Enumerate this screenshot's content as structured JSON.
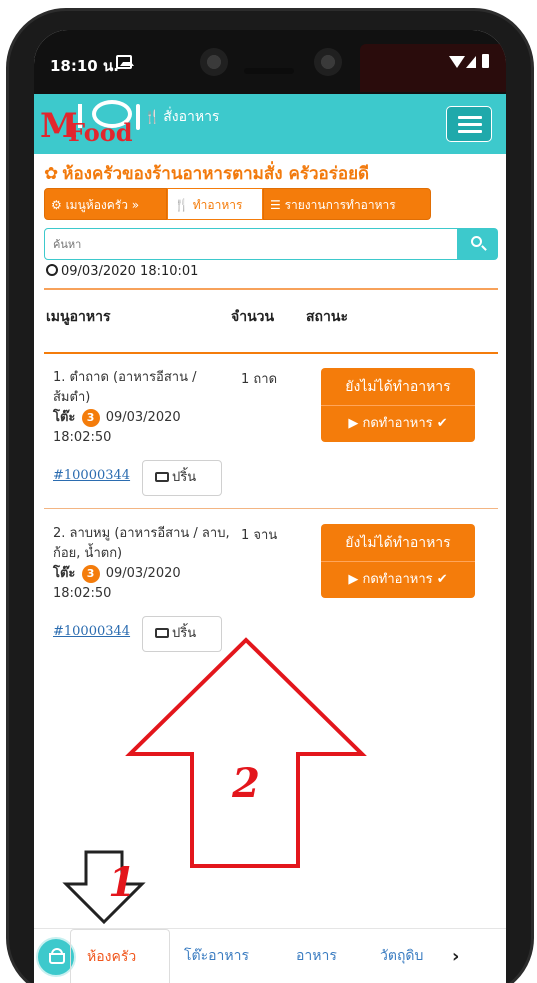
{
  "status_bar": {
    "time": "18:10 น."
  },
  "navbar": {
    "logo_m": "M",
    "logo_food": "Food",
    "order_icon": "🍴",
    "order_label": "สั่งอาหาร"
  },
  "page": {
    "title": "ห้องครัวของร้านอาหารตามสั่ง ครัวอร่อยดี",
    "buttons": {
      "kitchen_menu": "⚙ เมนูห้องครัว »",
      "cook": "🍴 ทำอาหาร",
      "report": "☰ รายงานการทำอาหาร"
    },
    "search_placeholder": "ค้นหา",
    "timestamp": "09/03/2020 18:10:01"
  },
  "table": {
    "headers": {
      "menu": "เมนูอาหาร",
      "qty": "จำนวน",
      "status": "สถานะ"
    },
    "rows": [
      {
        "name": "1. ตำถาด (อาหารอีสาน / ส้มตำ)",
        "table_label": "โต๊ะ",
        "table_no": "3",
        "ordered_at": "09/03/2020 18:02:50",
        "order_no": "#10000344",
        "print_label": "ปริ้น",
        "qty": "1 ถาด",
        "status": "ยังไม่ได้ทำอาหาร",
        "action": "▶ กดทำอาหาร ✔"
      },
      {
        "name": "2. ลาบหมู (อาหารอีสาน / ลาบ, ก้อย, น้ำตก)",
        "table_label": "โต๊ะ",
        "table_no": "3",
        "ordered_at": "09/03/2020 18:02:50",
        "order_no": "#10000344",
        "print_label": "ปริ้น",
        "qty": "1 จาน",
        "status": "ยังไม่ได้ทำอาหาร",
        "action": "▶ กดทำอาหาร ✔"
      }
    ]
  },
  "annotations": {
    "label_1": "1",
    "label_2": "2",
    "arrow_color": "#e3161c"
  },
  "bottom_nav": {
    "kitchen": "ห้องครัว",
    "tables": "โต๊ะอาหาร",
    "food": "อาหาร",
    "raw": "วัตถุดิบ",
    "next": "›"
  },
  "colors": {
    "accent_teal": "#3dc9cc",
    "accent_orange": "#f47c0b",
    "brand_red": "#e2262d"
  }
}
